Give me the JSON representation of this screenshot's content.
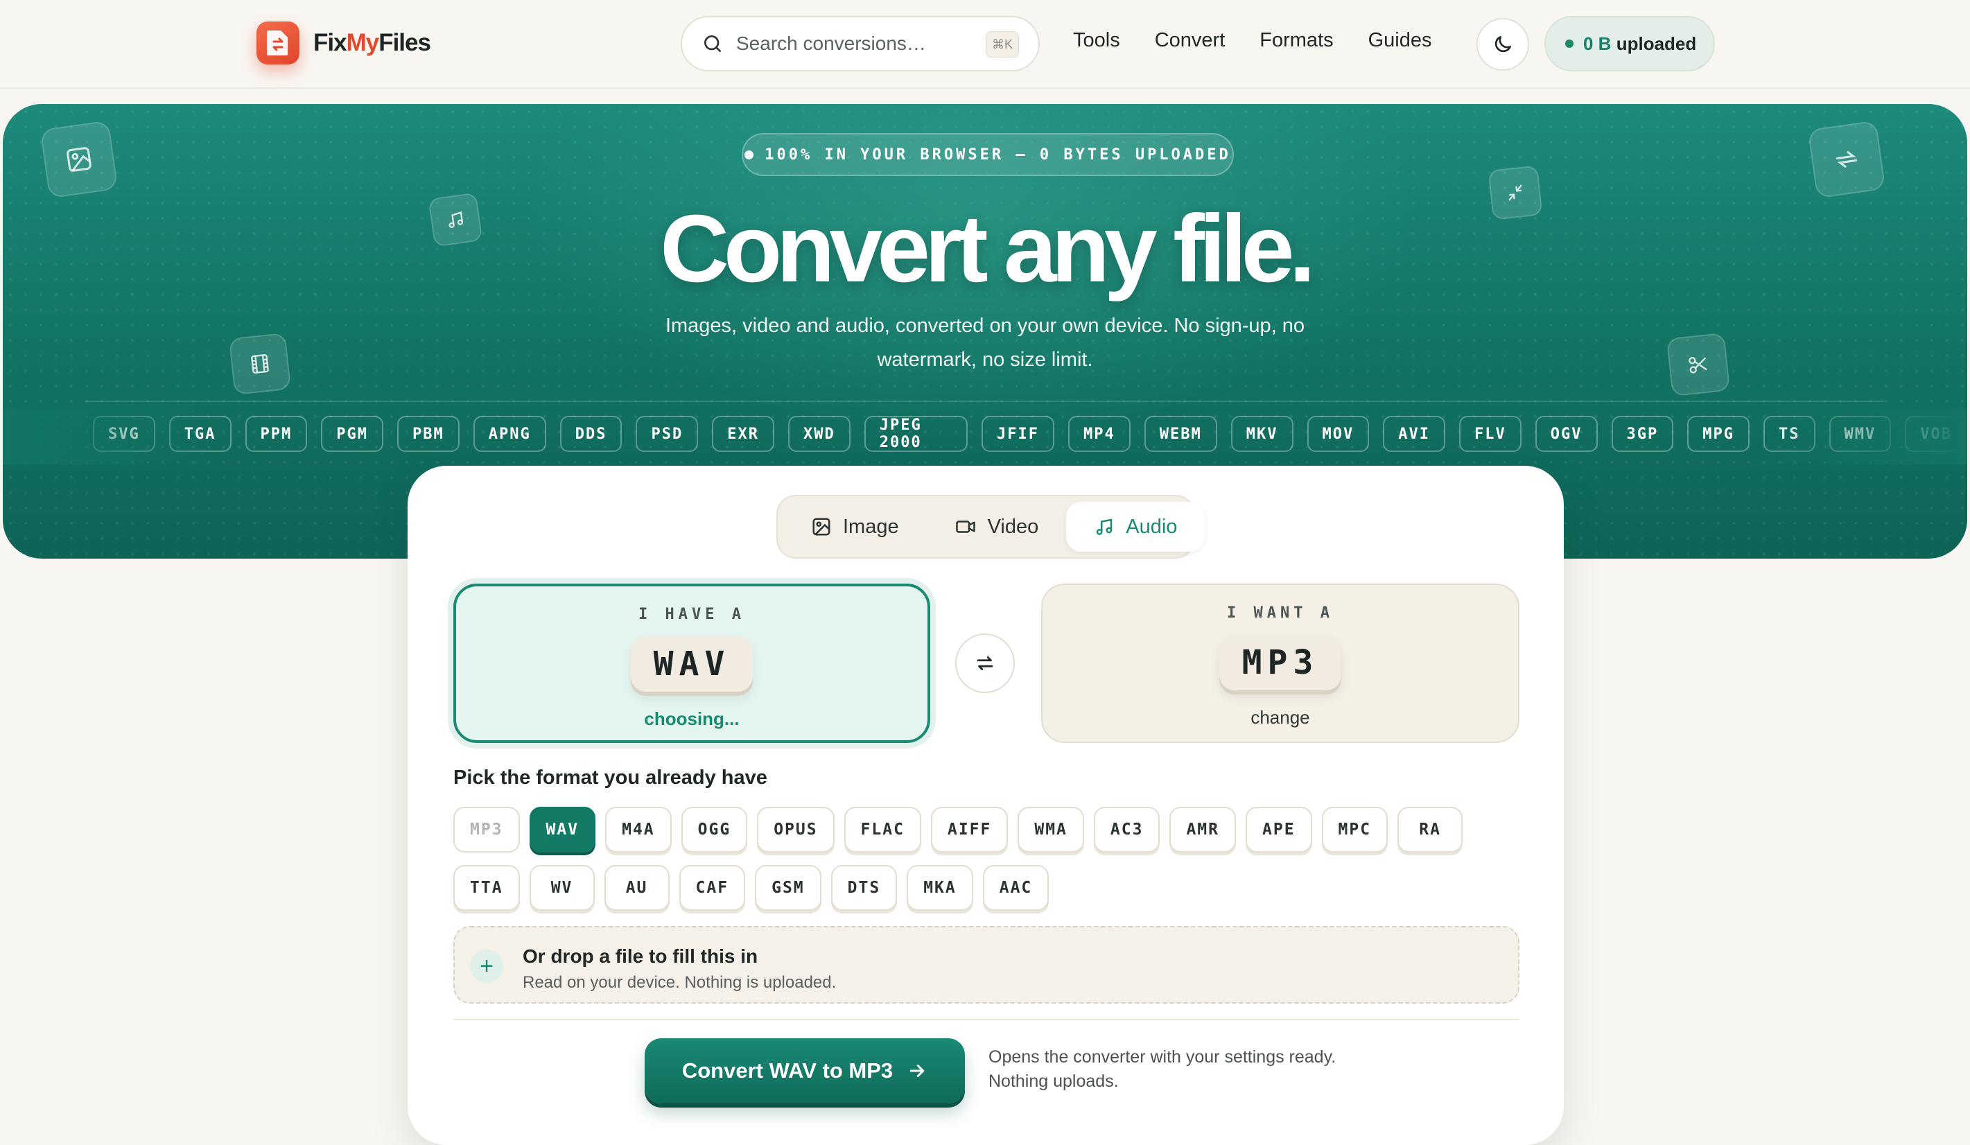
{
  "nav": {
    "brand_prefix": "Fix",
    "brand_accent": "My",
    "brand_suffix": "Files",
    "search_placeholder": "Search conversions…",
    "search_shortcut": "⌘K",
    "links": [
      "Tools",
      "Convert",
      "Formats",
      "Guides"
    ],
    "theme_icon": "moon-icon",
    "upload_count": "0 B",
    "upload_suffix": "uploaded"
  },
  "hero": {
    "badge": "100% IN YOUR BROWSER — 0 BYTES UPLOADED",
    "headline": "Convert any file.",
    "subline": "Images, video and audio, converted on your own device. No sign-up, no watermark, no size limit.",
    "format_chips": [
      "SVG",
      "TGA",
      "PPM",
      "PGM",
      "PBM",
      "APNG",
      "DDS",
      "PSD",
      "EXR",
      "XWD",
      "JPEG 2000",
      "JFIF",
      "MP4",
      "WEBM",
      "MKV",
      "MOV",
      "AVI",
      "FLV",
      "OGV",
      "3GP",
      "MPG",
      "TS",
      "WMV",
      "VOB"
    ]
  },
  "tabs": [
    {
      "label": "Image",
      "icon": "image-icon",
      "active": false
    },
    {
      "label": "Video",
      "icon": "video-icon",
      "active": false
    },
    {
      "label": "Audio",
      "icon": "music-icon",
      "active": true
    }
  ],
  "converter": {
    "have_label": "I HAVE A",
    "have_format": "WAV",
    "have_status": "choosing...",
    "want_label": "I WANT A",
    "want_format": "MP3",
    "want_action": "change",
    "pick_title": "Pick the format you already have",
    "formats_row1": [
      "MP3",
      "WAV",
      "M4A",
      "OGG",
      "OPUS",
      "FLAC",
      "AIFF",
      "WMA",
      "AC3",
      "AMR",
      "APE",
      "MPC",
      "RA"
    ],
    "formats_row2": [
      "TTA",
      "WV",
      "AU",
      "CAF",
      "GSM",
      "DTS",
      "MKA",
      "AAC"
    ],
    "selected_format": "WAV",
    "disabled_format": "MP3",
    "drop_title": "Or drop a file to fill this in",
    "drop_subtitle": "Read on your device. Nothing is uploaded.",
    "cta_label": "Convert WAV to MP3",
    "cta_note": "Opens the converter with your settings ready. Nothing uploads."
  },
  "colors": {
    "brand_orange": "#e4482d",
    "teal": "#137a66",
    "background": "#f8f6f1"
  }
}
